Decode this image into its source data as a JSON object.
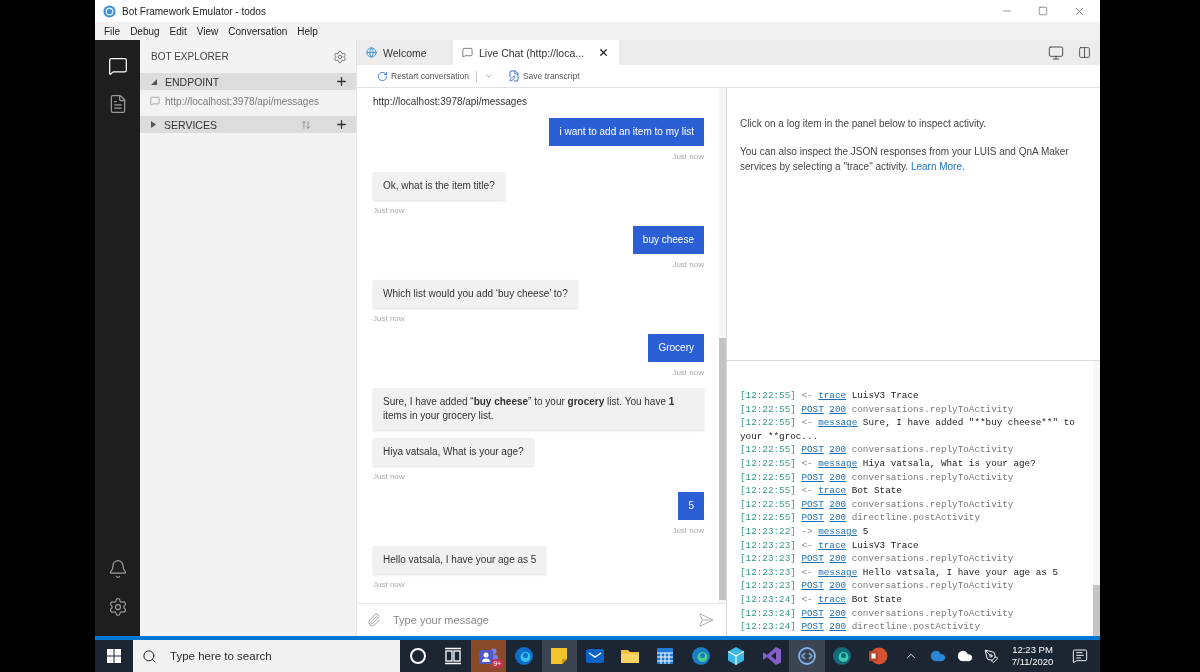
{
  "window": {
    "title": "Bot Framework Emulator - todos",
    "menu": [
      "File",
      "Debug",
      "Edit",
      "View",
      "Conversation",
      "Help"
    ]
  },
  "activity_bar": {
    "top": [
      {
        "kind": "chat",
        "selected": true
      },
      {
        "kind": "document",
        "selected": false
      }
    ],
    "bottom": [
      {
        "kind": "notifications"
      },
      {
        "kind": "settings"
      }
    ]
  },
  "explorer": {
    "title": "BOT EXPLORER",
    "sections": [
      {
        "title": "ENDPOINT",
        "expanded": true,
        "sortable": false,
        "items": [
          "http://localhost:3978/api/messages"
        ]
      },
      {
        "title": "SERVICES",
        "expanded": false,
        "sortable": true
      }
    ]
  },
  "tabs": [
    {
      "kind": "welcome",
      "label": "Welcome",
      "selected": false
    },
    {
      "kind": "chat",
      "label": "Live Chat (http://loca...",
      "selected": true
    }
  ],
  "toolbar": [
    {
      "kind": "restart",
      "label": "Restart conversation",
      "menu": true
    },
    {
      "kind": "save",
      "label": "Save transcript",
      "menu": false
    }
  ],
  "chat": {
    "endpoint": "http://localhost:3978/api/messages",
    "messages": [
      {
        "kind": "user",
        "text": "i want to add an item to my list",
        "timestamp": "Just now"
      },
      {
        "kind": "bot",
        "text": "Ok, what is the item title?",
        "timestamp": "Just now"
      },
      {
        "kind": "user",
        "text": "buy cheese",
        "timestamp": "Just now"
      },
      {
        "kind": "bot",
        "text": "Which list would you add ‘buy cheese’ to?",
        "timestamp": "Just now"
      },
      {
        "kind": "user",
        "text": "Grocery",
        "timestamp": "Just now"
      },
      {
        "kind": "bot",
        "text": "Sure, I have added “**buy cheese**” to your **grocery** list. You have **1** items in your grocery list."
      },
      {
        "kind": "bot",
        "text": "Hiya vatsala, What is your age?",
        "timestamp": "Just now"
      },
      {
        "kind": "user",
        "text": "5",
        "timestamp": "Just now"
      },
      {
        "kind": "bot",
        "text": "Hello vatsala, I have your age as 5",
        "timestamp": "Just now"
      }
    ],
    "input": {
      "placeholder": "Type your message"
    }
  },
  "inspector": {
    "paragraphs": [
      {
        "text": "Click on a log item in the panel below to inspect activity."
      },
      {
        "text": "You can also inspect the JSON responses from your LUIS and QnA Maker services by selecting a \"trace\" activity.",
        "link": "Learn More."
      }
    ]
  },
  "log": [
    {
      "kind": "activity",
      "time": "[12:22:55]",
      "arrow": "<-",
      "type": "trace",
      "text": "LuisV3 Trace"
    },
    {
      "kind": "request",
      "time": "[12:22:55]",
      "method": "POST",
      "status": "200",
      "route": "conversations.replyToActivity"
    },
    {
      "kind": "activity",
      "time": "[12:22:55]",
      "arrow": "<-",
      "type": "message",
      "text": "Sure, I have added \"**buy cheese**\" to your **groc..."
    },
    {
      "kind": "request",
      "time": "[12:22:55]",
      "method": "POST",
      "status": "200",
      "route": "conversations.replyToActivity"
    },
    {
      "kind": "activity",
      "time": "[12:22:55]",
      "arrow": "<-",
      "type": "message",
      "text": "Hiya vatsala, What is your age?"
    },
    {
      "kind": "request",
      "time": "[12:22:55]",
      "method": "POST",
      "status": "200",
      "route": "conversations.replyToActivity"
    },
    {
      "kind": "activity",
      "time": "[12:22:55]",
      "arrow": "<-",
      "type": "trace",
      "text": "Bot State"
    },
    {
      "kind": "request",
      "time": "[12:22:55]",
      "method": "POST",
      "status": "200",
      "route": "conversations.replyToActivity"
    },
    {
      "kind": "request",
      "time": "[12:22:55]",
      "method": "POST",
      "status": "200",
      "route": "directline.postActivity"
    },
    {
      "kind": "activity",
      "time": "[12:23:22]",
      "arrow": "->",
      "type": "message",
      "text": "5"
    },
    {
      "kind": "activity",
      "time": "[12:23:23]",
      "arrow": "<-",
      "type": "trace",
      "text": "LuisV3 Trace"
    },
    {
      "kind": "request",
      "time": "[12:23:23]",
      "method": "POST",
      "status": "200",
      "route": "conversations.replyToActivity"
    },
    {
      "kind": "activity",
      "time": "[12:23:23]",
      "arrow": "<-",
      "type": "message",
      "text": "Hello vatsala, I have your age as 5"
    },
    {
      "kind": "request",
      "time": "[12:23:23]",
      "method": "POST",
      "status": "200",
      "route": "conversations.replyToActivity"
    },
    {
      "kind": "activity",
      "time": "[12:23:24]",
      "arrow": "<-",
      "type": "trace",
      "text": "Bot State"
    },
    {
      "kind": "request",
      "time": "[12:23:24]",
      "method": "POST",
      "status": "200",
      "route": "conversations.replyToActivity"
    },
    {
      "kind": "request",
      "time": "[12:23:24]",
      "method": "POST",
      "status": "200",
      "route": "directline.postActivity"
    }
  ],
  "taskbar": {
    "search": {
      "placeholder": "Type here to search"
    },
    "apps": [
      {
        "kind": "ring",
        "active": false,
        "alert": false
      },
      {
        "kind": "task_view",
        "active": false,
        "alert": false
      },
      {
        "kind": "people",
        "badge": "9+",
        "active": false,
        "alert": true
      },
      {
        "kind": "browser",
        "active": false,
        "alert": false
      },
      {
        "kind": "note",
        "active": true,
        "alert": false
      },
      {
        "kind": "mail",
        "active": false,
        "alert": false
      },
      {
        "kind": "folder",
        "active": false,
        "alert": false
      },
      {
        "kind": "calendar",
        "active": false,
        "alert": false
      },
      {
        "kind": "browser_beta",
        "active": false,
        "alert": false
      },
      {
        "kind": "cube",
        "active": false,
        "alert": false
      },
      {
        "kind": "ribbon",
        "active": false,
        "alert": false
      },
      {
        "kind": "code",
        "active": true,
        "alert": false
      },
      {
        "kind": "browser_dev",
        "active": false,
        "alert": false
      },
      {
        "kind": "slides",
        "active": false,
        "alert": false
      }
    ],
    "tray": [
      {
        "kind": "chevron"
      },
      {
        "kind": "sync_cloud"
      },
      {
        "kind": "cloud"
      },
      {
        "kind": "pen"
      }
    ],
    "clock": {
      "time": "12:23 PM",
      "date": "7/11/2020"
    }
  }
}
